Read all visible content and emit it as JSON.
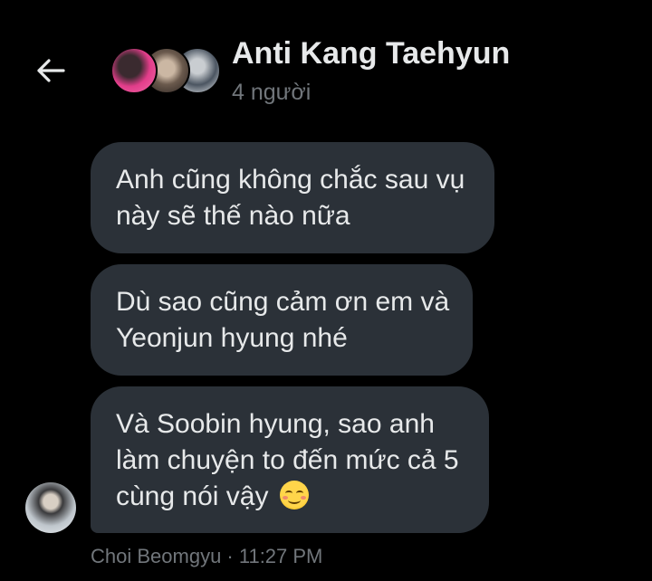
{
  "header": {
    "back_icon": "arrow-left-icon",
    "title": "Anti Kang Taehyun",
    "subtitle": "4 người",
    "avatars": [
      "group-member-avatar",
      "group-member-avatar",
      "group-member-avatar"
    ]
  },
  "messages": [
    {
      "lines": [
        "Anh cũng không chắc sau vụ",
        "này sẽ thế nào nữa"
      ]
    },
    {
      "lines": [
        "Dù sao cũng cảm ơn em và",
        "Yeonjun hyung nhé"
      ]
    },
    {
      "lines": [
        "Và Soobin hyung, sao anh",
        "làm chuyện to đến mức cả 5",
        "cùng nói vậy"
      ],
      "emoji": "smiling-face-with-blush-icon"
    }
  ],
  "footer": {
    "meta": "Choi Beomgyu · 11:27 PM"
  },
  "colors": {
    "background": "#000000",
    "bubble": "#2b3138",
    "text": "#e7e9ea",
    "muted": "#71767b"
  }
}
